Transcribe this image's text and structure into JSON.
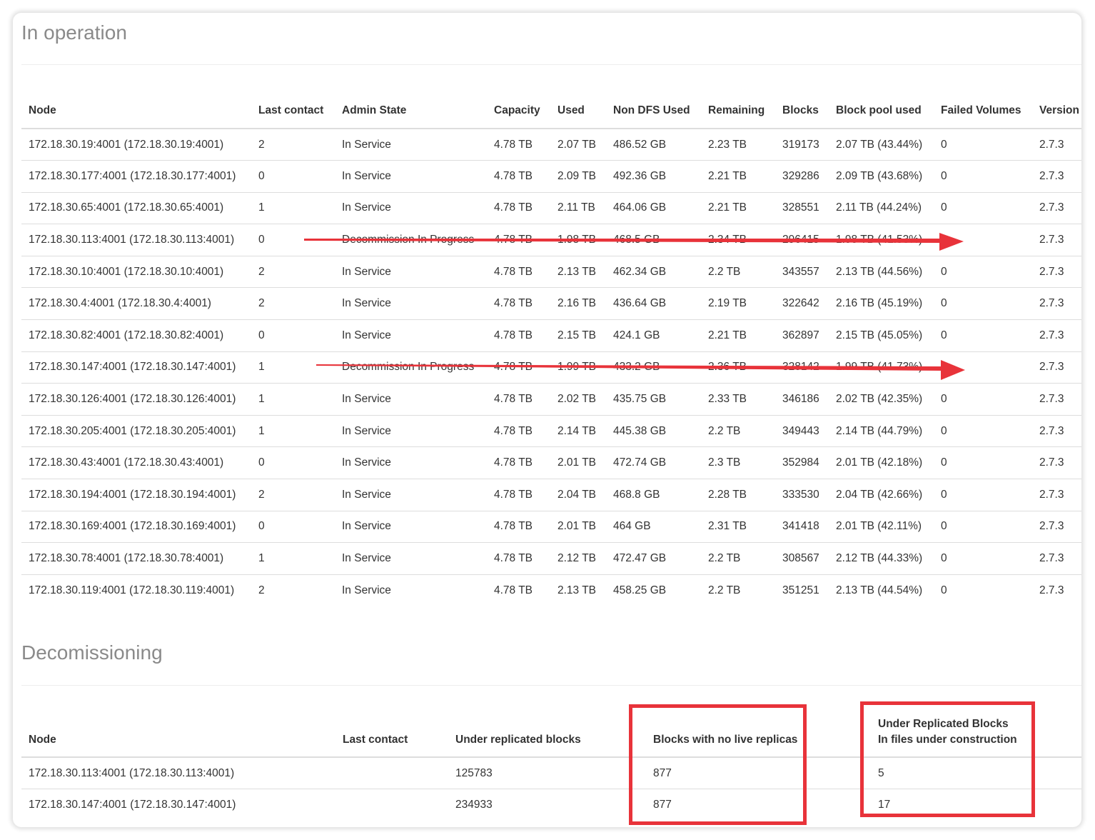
{
  "in_operation": {
    "title": "In operation",
    "columns": [
      "Node",
      "Last contact",
      "Admin State",
      "Capacity",
      "Used",
      "Non DFS Used",
      "Remaining",
      "Blocks",
      "Block pool used",
      "Failed Volumes",
      "Version"
    ],
    "rows": [
      [
        "172.18.30.19:4001 (172.18.30.19:4001)",
        "2",
        "In Service",
        "4.78 TB",
        "2.07 TB",
        "486.52 GB",
        "2.23 TB",
        "319173",
        "2.07 TB (43.44%)",
        "0",
        "2.7.3"
      ],
      [
        "172.18.30.177:4001 (172.18.30.177:4001)",
        "0",
        "In Service",
        "4.78 TB",
        "2.09 TB",
        "492.36 GB",
        "2.21 TB",
        "329286",
        "2.09 TB (43.68%)",
        "0",
        "2.7.3"
      ],
      [
        "172.18.30.65:4001 (172.18.30.65:4001)",
        "1",
        "In Service",
        "4.78 TB",
        "2.11 TB",
        "464.06 GB",
        "2.21 TB",
        "328551",
        "2.11 TB (44.24%)",
        "0",
        "2.7.3"
      ],
      [
        "172.18.30.113:4001 (172.18.30.113:4001)",
        "0",
        "Decommission In Progress",
        "4.78 TB",
        "1.98 TB",
        "468.5 GB",
        "2.34 TB",
        "296415",
        "1.98 TB (41.53%)",
        "0",
        "2.7.3"
      ],
      [
        "172.18.30.10:4001 (172.18.30.10:4001)",
        "2",
        "In Service",
        "4.78 TB",
        "2.13 TB",
        "462.34 GB",
        "2.2 TB",
        "343557",
        "2.13 TB (44.56%)",
        "0",
        "2.7.3"
      ],
      [
        "172.18.30.4:4001 (172.18.30.4:4001)",
        "2",
        "In Service",
        "4.78 TB",
        "2.16 TB",
        "436.64 GB",
        "2.19 TB",
        "322642",
        "2.16 TB (45.19%)",
        "0",
        "2.7.3"
      ],
      [
        "172.18.30.82:4001 (172.18.30.82:4001)",
        "0",
        "In Service",
        "4.78 TB",
        "2.15 TB",
        "424.1 GB",
        "2.21 TB",
        "362897",
        "2.15 TB (45.05%)",
        "0",
        "2.7.3"
      ],
      [
        "172.18.30.147:4001 (172.18.30.147:4001)",
        "1",
        "Decommission In Progress",
        "4.78 TB",
        "1.99 TB",
        "433.2 GB",
        "2.36 TB",
        "328142",
        "1.99 TB (41.73%)",
        "0",
        "2.7.3"
      ],
      [
        "172.18.30.126:4001 (172.18.30.126:4001)",
        "1",
        "In Service",
        "4.78 TB",
        "2.02 TB",
        "435.75 GB",
        "2.33 TB",
        "346186",
        "2.02 TB (42.35%)",
        "0",
        "2.7.3"
      ],
      [
        "172.18.30.205:4001 (172.18.30.205:4001)",
        "1",
        "In Service",
        "4.78 TB",
        "2.14 TB",
        "445.38 GB",
        "2.2 TB",
        "349443",
        "2.14 TB (44.79%)",
        "0",
        "2.7.3"
      ],
      [
        "172.18.30.43:4001 (172.18.30.43:4001)",
        "0",
        "In Service",
        "4.78 TB",
        "2.01 TB",
        "472.74 GB",
        "2.3 TB",
        "352984",
        "2.01 TB (42.18%)",
        "0",
        "2.7.3"
      ],
      [
        "172.18.30.194:4001 (172.18.30.194:4001)",
        "2",
        "In Service",
        "4.78 TB",
        "2.04 TB",
        "468.8 GB",
        "2.28 TB",
        "333530",
        "2.04 TB (42.66%)",
        "0",
        "2.7.3"
      ],
      [
        "172.18.30.169:4001 (172.18.30.169:4001)",
        "0",
        "In Service",
        "4.78 TB",
        "2.01 TB",
        "464 GB",
        "2.31 TB",
        "341418",
        "2.01 TB (42.11%)",
        "0",
        "2.7.3"
      ],
      [
        "172.18.30.78:4001 (172.18.30.78:4001)",
        "1",
        "In Service",
        "4.78 TB",
        "2.12 TB",
        "472.47 GB",
        "2.2 TB",
        "308567",
        "2.12 TB (44.33%)",
        "0",
        "2.7.3"
      ],
      [
        "172.18.30.119:4001 (172.18.30.119:4001)",
        "2",
        "In Service",
        "4.78 TB",
        "2.13 TB",
        "458.25 GB",
        "2.2 TB",
        "351251",
        "2.13 TB (44.54%)",
        "0",
        "2.7.3"
      ]
    ]
  },
  "decommissioning": {
    "title": "Decomissioning",
    "columns": [
      "Node",
      "Last contact",
      "Under replicated blocks",
      "Blocks with no live replicas",
      "Under Replicated Blocks\nIn files under construction"
    ],
    "rows": [
      [
        "172.18.30.113:4001 (172.18.30.113:4001)",
        "",
        "125783",
        "877",
        "5"
      ],
      [
        "172.18.30.147:4001 (172.18.30.147:4001)",
        "",
        "234933",
        "877",
        "17"
      ]
    ]
  },
  "annotations": {
    "arrow_color": "#e8333a",
    "box_color": "#e8333a"
  }
}
